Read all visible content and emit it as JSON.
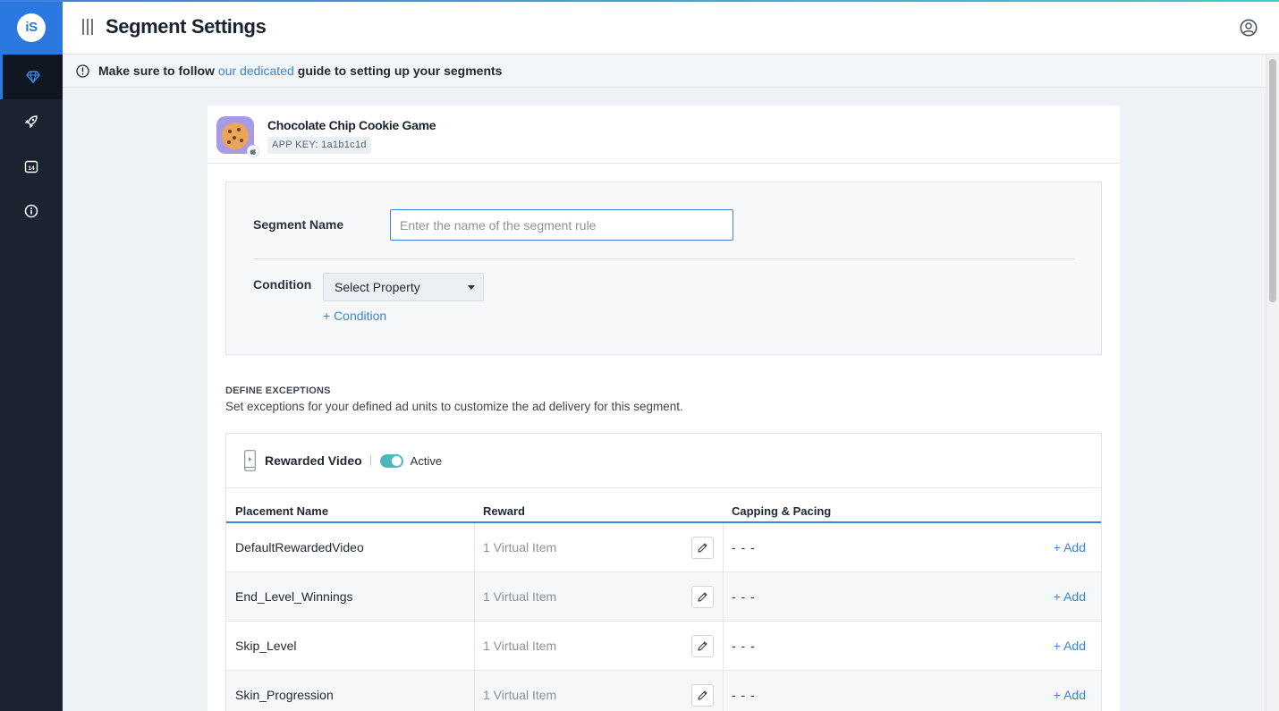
{
  "app": {
    "logo_text": "iS",
    "page_title": "Segment Settings"
  },
  "sidebar": {
    "items": [
      {
        "icon": "diamond-icon",
        "active": true
      },
      {
        "icon": "rocket-icon",
        "active": false
      },
      {
        "icon": "calendar-icon",
        "badge": "14",
        "active": false
      },
      {
        "icon": "info-icon",
        "active": false
      }
    ]
  },
  "notice": {
    "prefix": "Make sure to follow",
    "link": "our dedicated",
    "suffix": "guide to setting up your segments"
  },
  "app_card": {
    "name": "Chocolate Chip Cookie Game",
    "app_key": "APP KEY: 1a1b1c1d"
  },
  "segment": {
    "name_label": "Segment Name",
    "name_placeholder": "Enter the name of the segment rule",
    "name_value": "",
    "condition_label": "Condition",
    "select_property": "Select Property",
    "add_condition": "+ Condition"
  },
  "exceptions": {
    "title": "DEFINE EXCEPTIONS",
    "description": "Set exceptions for your defined ad units to customize the ad delivery for this segment."
  },
  "rewarded_video": {
    "title": "Rewarded Video",
    "status": "Active",
    "columns": [
      "Placement Name",
      "Reward",
      "Capping & Pacing"
    ],
    "rows": [
      {
        "name": "DefaultRewardedVideo",
        "reward": "1 Virtual Item",
        "capping": "- - -",
        "add": "+ Add"
      },
      {
        "name": "End_Level_Winnings",
        "reward": "1 Virtual Item",
        "capping": "- - -",
        "add": "+ Add"
      },
      {
        "name": "Skip_Level",
        "reward": "1 Virtual Item",
        "capping": "- - -",
        "add": "+ Add"
      },
      {
        "name": "Skin_Progression",
        "reward": "1 Virtual Item",
        "capping": "- - -",
        "add": "+ Add"
      }
    ]
  },
  "colors": {
    "brand": "#2a78e0",
    "sidebar": "#1b2331",
    "link": "#3b83d9",
    "toggle": "#4fb6c0"
  }
}
